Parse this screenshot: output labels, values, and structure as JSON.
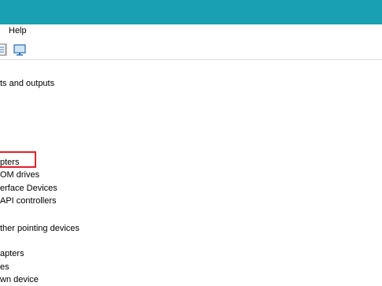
{
  "window": {
    "accent": "#1aa0b3"
  },
  "menubar": {
    "items": [
      {
        "label": "Help"
      }
    ]
  },
  "toolbar": {
    "icons": [
      {
        "name": "properties-icon"
      },
      {
        "name": "scan-hardware-icon"
      }
    ]
  },
  "tree": {
    "items": [
      {
        "label": "ts and outputs"
      },
      {
        "label": "pters"
      },
      {
        "label": "OM drives"
      },
      {
        "label": "erface Devices"
      },
      {
        "label": "API controllers"
      },
      {
        "label": "ther pointing devices"
      },
      {
        "label": "apters"
      },
      {
        "label": "es"
      },
      {
        "label": "wn device"
      }
    ],
    "highlight_color": "#e0202a"
  }
}
